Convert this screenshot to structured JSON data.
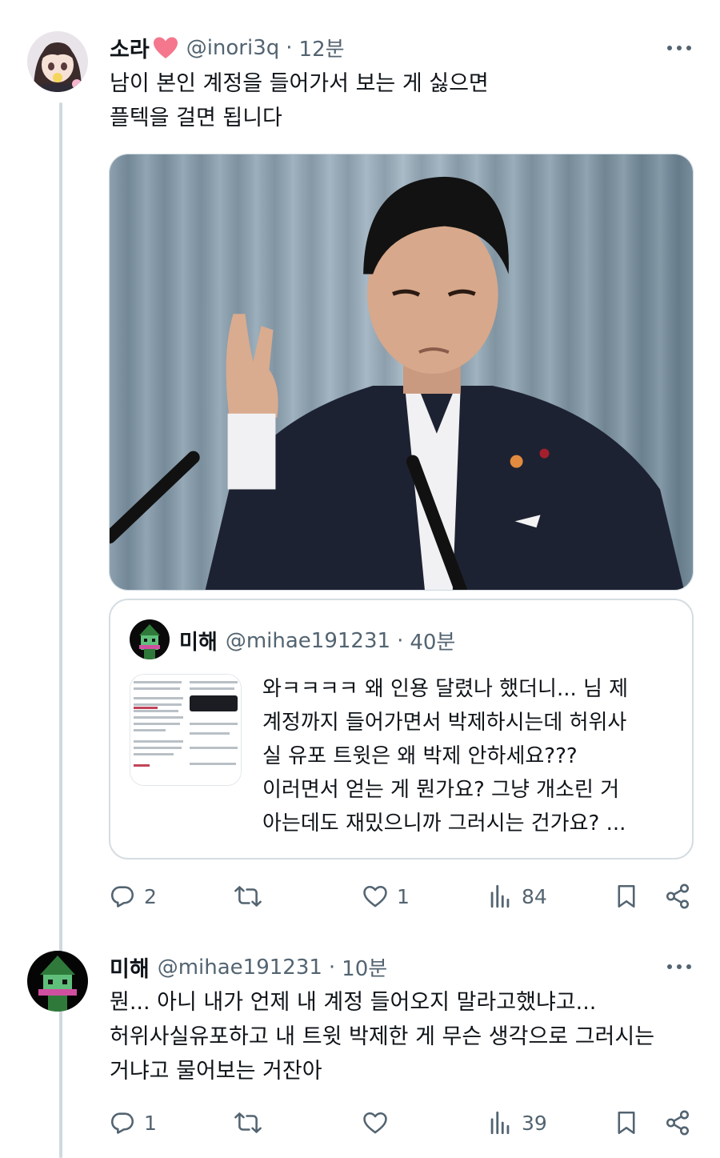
{
  "tweet1": {
    "display_name": "소라",
    "handle": "@inori3q",
    "separator": "·",
    "time": "12분",
    "text_lines": [
      "남이 본인 계정을 들어가서 보는 게 싫으면",
      "플텍을 걸면 됩니다"
    ],
    "quote": {
      "display_name": "미해",
      "handle": "@mihae191231",
      "separator": "·",
      "time": "40분",
      "text_lines": [
        "와ㅋㅋㅋㅋ 왜 인용 달렸나 했더니... 님 제",
        "계정까지 들어가면서 박제하시는데 허위사",
        "실 유포 트윗은 왜 박제 안하세요???",
        "이러면서 얻는 게 뭔가요? 그냥 개소린 거",
        "아는데도 재밌으니까 그러시는 건가요? ..."
      ]
    },
    "actions": {
      "reply_count": "2",
      "retweet_count": "",
      "like_count": "1",
      "view_count": "84"
    }
  },
  "tweet2": {
    "display_name": "미해",
    "handle": "@mihae191231",
    "separator": "·",
    "time": "10분",
    "text_lines": [
      "뭔... 아니 내가 언제 내 계정 들어오지 말라고했냐고...",
      "허위사실유포하고 내 트윗 박제한 게 무슨 생각으로 그러시는",
      "거냐고 물어보는 거잔아"
    ],
    "actions": {
      "reply_count": "1",
      "retweet_count": "",
      "like_count": "",
      "view_count": "39"
    }
  },
  "icons": {
    "more": "more-dots-icon",
    "reply": "reply-icon",
    "retweet": "retweet-icon",
    "like": "heart-icon",
    "views": "views-icon",
    "bookmark": "bookmark-icon",
    "share": "share-icon"
  },
  "colors": {
    "text_primary": "#0f1419",
    "text_secondary": "#536471",
    "border": "#cfd9de",
    "heart_emoji": "#f4778d"
  }
}
